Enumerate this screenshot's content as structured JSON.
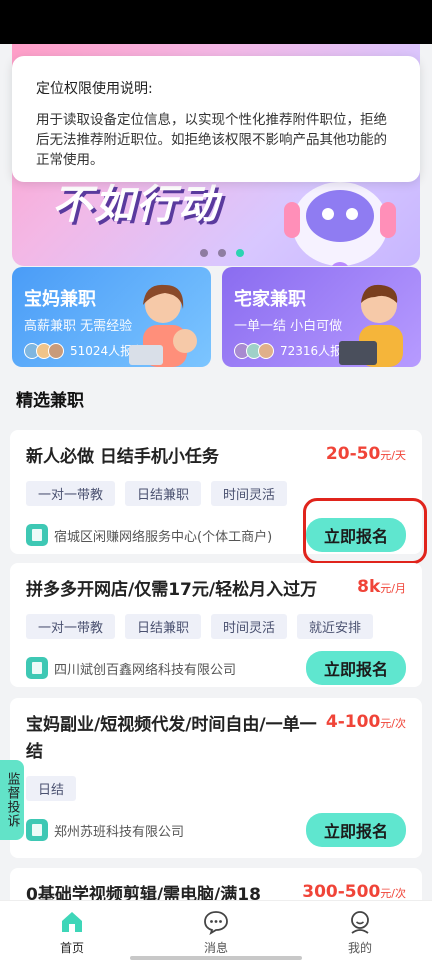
{
  "permission_dialog": {
    "title": "定位权限使用说明:",
    "text": "用于读取设备定位信息，以实现个性化推荐附件职位，拒绝后无法推荐附近职位。如拒绝该权限不影响产品其他功能的正常使用。"
  },
  "banner": {
    "slogan": "不如行动"
  },
  "categories": [
    {
      "title": "宝妈兼职",
      "subtitle": "高薪兼职 无需经验",
      "count": "51024人报名"
    },
    {
      "title": "宅家兼职",
      "subtitle": "一单一结 小白可做",
      "count": "72316人报名"
    }
  ],
  "section_title": "精选兼职",
  "jobs": [
    {
      "title": "新人必做 日结手机小任务",
      "salary": "20-50",
      "salary_unit": "元/天",
      "tags": [
        "一对一带教",
        "日结兼职",
        "时间灵活"
      ],
      "company": "宿城区闲赚网络服务中心(个体工商户)",
      "apply_label": "立即报名"
    },
    {
      "title": "拼多多开网店/仅需17元/轻松月入过万",
      "salary": "8k",
      "salary_unit": "元/月",
      "tags": [
        "一对一带教",
        "日结兼职",
        "时间灵活",
        "就近安排"
      ],
      "company": "四川斌创百鑫网络科技有限公司",
      "apply_label": "立即报名"
    },
    {
      "title": "宝妈副业/短视频代发/时间自由/一单一结",
      "salary": "4-100",
      "salary_unit": "元/次",
      "tags": [
        "日结"
      ],
      "company": "郑州苏班科技有限公司",
      "apply_label": "立即报名"
    },
    {
      "title": "0基础学视频剪辑/需电脑/满18",
      "salary": "300-500",
      "salary_unit": "元/次"
    }
  ],
  "complaint_label": "监督投诉",
  "tabbar": [
    {
      "label": "首页"
    },
    {
      "label": "消息"
    },
    {
      "label": "我的"
    }
  ],
  "colors": {
    "accent": "#5fe6cf",
    "salary": "#f04438",
    "highlight": "#e0241c"
  }
}
